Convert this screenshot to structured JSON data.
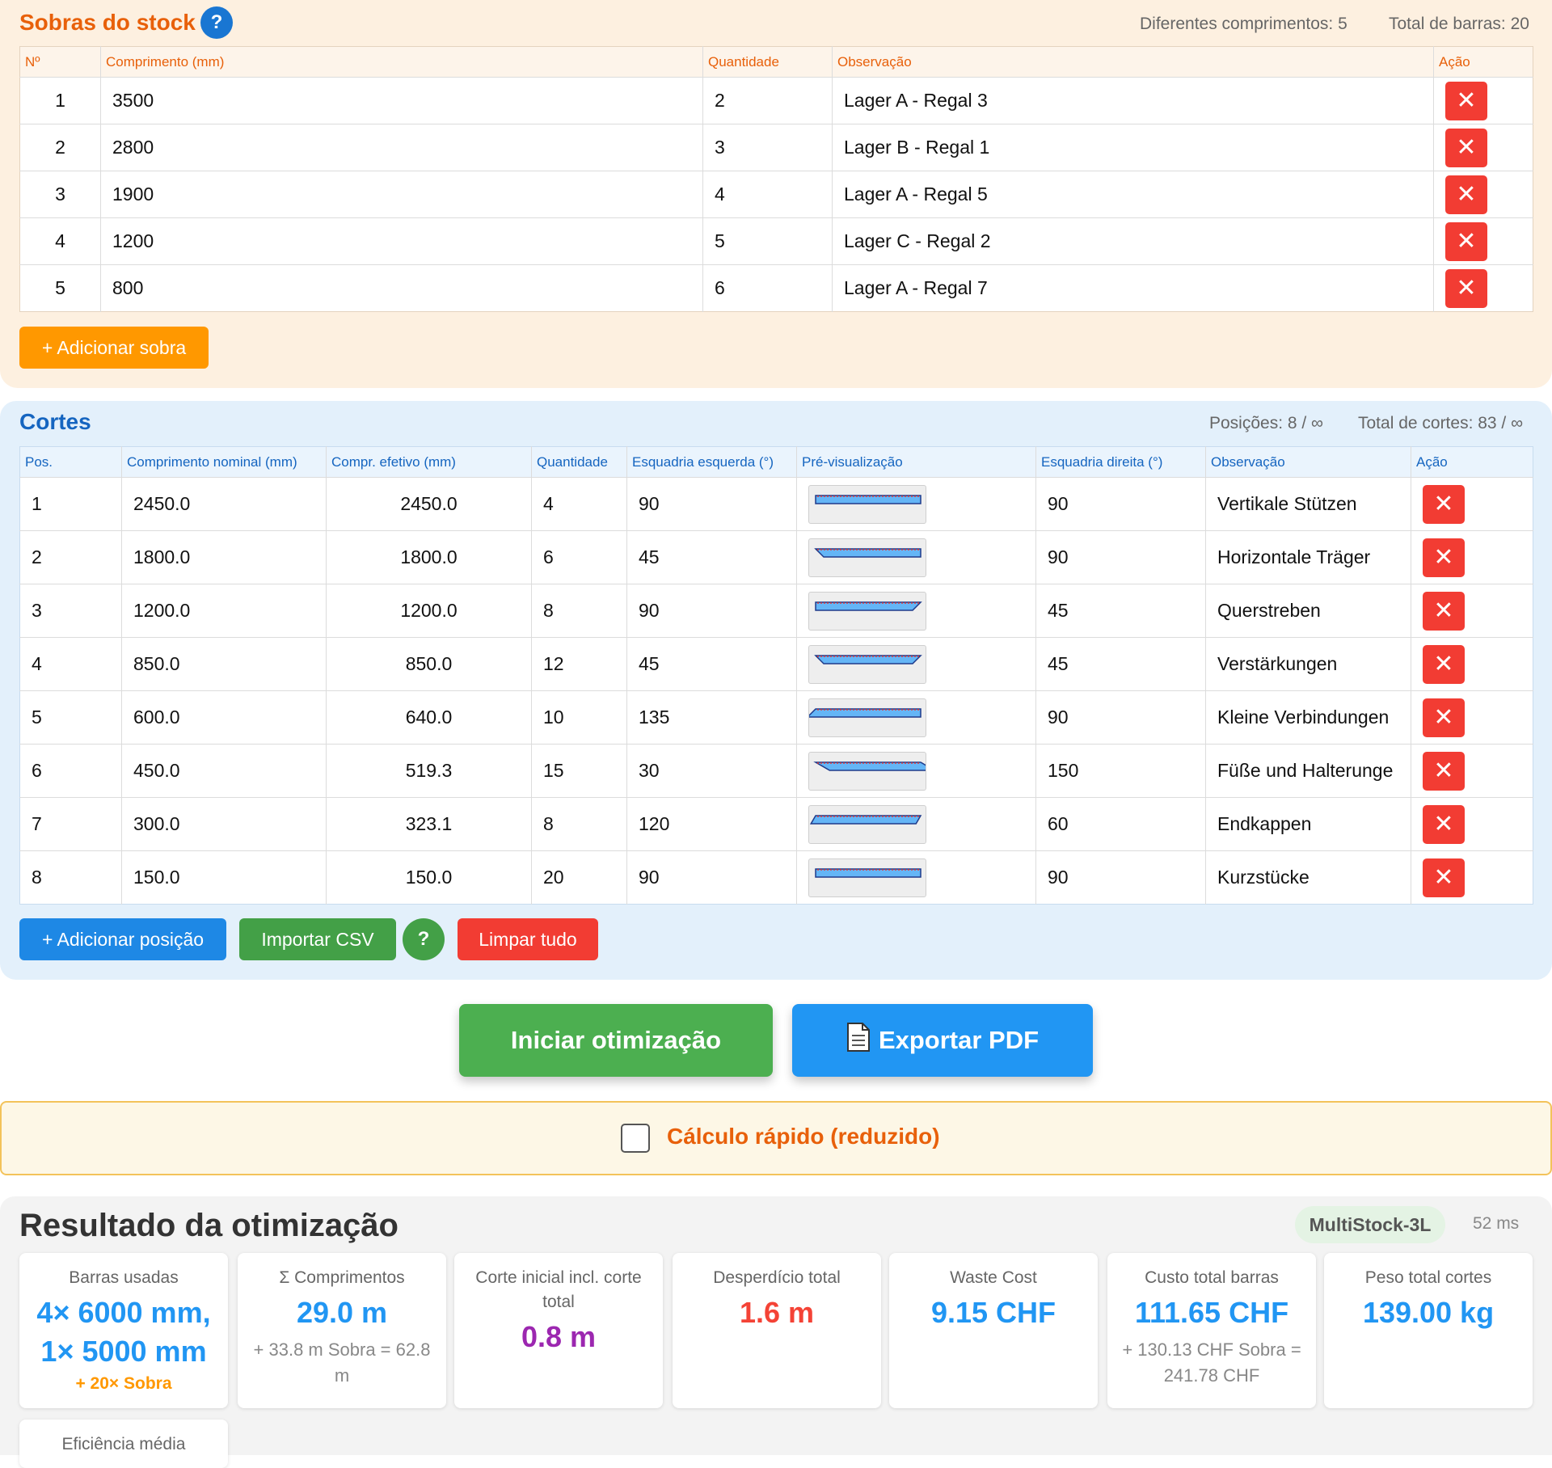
{
  "stock": {
    "title": "Sobras do stock",
    "meta_lengths": "Diferentes comprimentos: 5",
    "meta_total": "Total de barras: 20",
    "columns": [
      "Nº",
      "Comprimento (mm)",
      "Quantidade",
      "Observação",
      "Ação"
    ],
    "rows": [
      {
        "n": "1",
        "length": "3500",
        "qty": "2",
        "note": "Lager A - Regal 3"
      },
      {
        "n": "2",
        "length": "2800",
        "qty": "3",
        "note": "Lager B - Regal 1"
      },
      {
        "n": "3",
        "length": "1900",
        "qty": "4",
        "note": "Lager A - Regal 5"
      },
      {
        "n": "4",
        "length": "1200",
        "qty": "5",
        "note": "Lager C - Regal 2"
      },
      {
        "n": "5",
        "length": "800",
        "qty": "6",
        "note": "Lager A - Regal 7"
      }
    ],
    "add_button": "+ Adicionar sobra"
  },
  "cuts": {
    "title": "Cortes",
    "meta_positions": "Posições: 8 / ∞",
    "meta_total": "Total de cortes: 83 / ∞",
    "columns": [
      "Pos.",
      "Comprimento nominal (mm)",
      "Compr. efetivo (mm)",
      "Quantidade",
      "Esquadria esquerda (°)",
      "Pré-visualização",
      "Esquadria direita (°)",
      "Observação",
      "Ação"
    ],
    "rows": [
      {
        "pos": "1",
        "nominal": "2450.0",
        "effective": "2450.0",
        "qty": "4",
        "left": "90",
        "right": "90",
        "note": "Vertikale Stützen"
      },
      {
        "pos": "2",
        "nominal": "1800.0",
        "effective": "1800.0",
        "qty": "6",
        "left": "45",
        "right": "90",
        "note": "Horizontale Träger"
      },
      {
        "pos": "3",
        "nominal": "1200.0",
        "effective": "1200.0",
        "qty": "8",
        "left": "90",
        "right": "45",
        "note": "Querstreben"
      },
      {
        "pos": "4",
        "nominal": "850.0",
        "effective": "850.0",
        "qty": "12",
        "left": "45",
        "right": "45",
        "note": "Verstärkungen"
      },
      {
        "pos": "5",
        "nominal": "600.0",
        "effective": "640.0",
        "qty": "10",
        "left": "135",
        "right": "90",
        "note": "Kleine Verbindungen"
      },
      {
        "pos": "6",
        "nominal": "450.0",
        "effective": "519.3",
        "qty": "15",
        "left": "30",
        "right": "150",
        "note": "Füße und Halterunge"
      },
      {
        "pos": "7",
        "nominal": "300.0",
        "effective": "323.1",
        "qty": "8",
        "left": "120",
        "right": "60",
        "note": "Endkappen"
      },
      {
        "pos": "8",
        "nominal": "150.0",
        "effective": "150.0",
        "qty": "20",
        "left": "90",
        "right": "90",
        "note": "Kurzstücke"
      }
    ],
    "add_button": "+ Adicionar posição",
    "import_button": "Importar CSV",
    "help": "?",
    "clear_button": "Limpar tudo"
  },
  "actions": {
    "optimize": "Iniciar otimização",
    "export": "Exportar PDF",
    "export_icon": "document-icon"
  },
  "quick": {
    "label": "Cálculo rápido (reduzido)",
    "checked": false
  },
  "results": {
    "title": "Resultado da otimização",
    "algorithm": "MultiStock-3L",
    "time": "52 ms",
    "cards": {
      "bars_label": "Barras usadas",
      "bars_value": "4× 6000 mm, 1× 5000 mm",
      "bars_sub": "+ 20× Sobra",
      "sum_label": "Σ Comprimentos",
      "sum_value": "29.0 m",
      "sum_sub": "+ 33.8 m Sobra = 62.8 m",
      "initial_label": "Corte inicial incl. corte total",
      "initial_value": "0.8 m",
      "waste_label": "Desperdício total",
      "waste_value": "1.6 m",
      "wastecost_label": "Waste Cost",
      "wastecost_value": "9.15 CHF",
      "cost_label": "Custo total barras",
      "cost_value": "111.65 CHF",
      "cost_sub": "+ 130.13 CHF Sobra = 241.78 CHF",
      "weight_label": "Peso total cortes",
      "weight_value": "139.00 kg",
      "eff_label": "Eficiência média"
    }
  },
  "colors": {
    "stock_accent": "#e8600a",
    "cuts_accent": "#1565c0",
    "delete": "#f23c33",
    "primary": "#1e88e5",
    "success": "#43a047",
    "warning": "#ff9800"
  }
}
